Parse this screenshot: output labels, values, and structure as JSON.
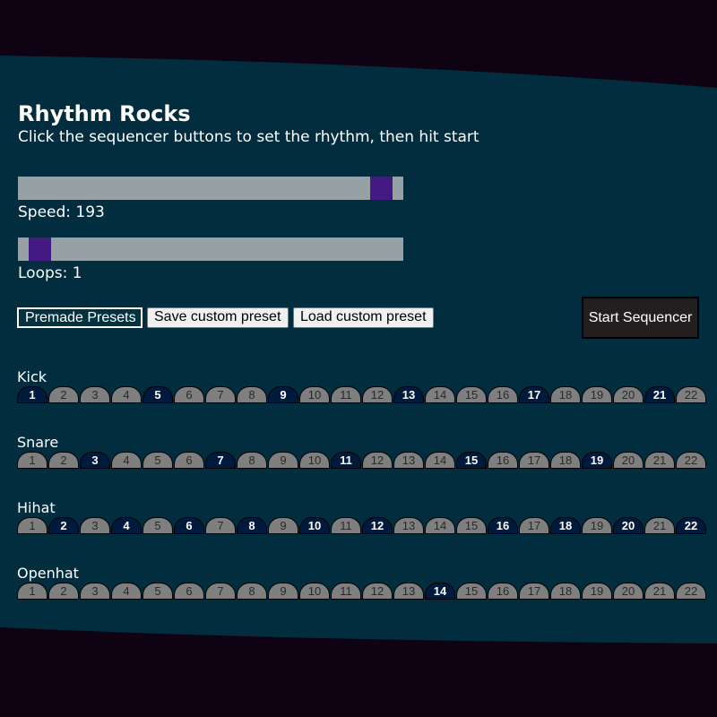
{
  "app": {
    "title": "Rhythm Rocks",
    "subtitle": "Click the sequencer buttons to set the rhythm, then hit start"
  },
  "colors": {
    "outer_bg": "#0f0213",
    "panel_bg": "#012d3e",
    "slider_track": "#95a1a5",
    "slider_thumb": "#441a82",
    "step_off": "#7f7f7f",
    "step_on": "#001a3d"
  },
  "sliders": {
    "speed": {
      "label": "Speed: 193",
      "fraction": 0.97
    },
    "loops": {
      "label": "Loops: 1",
      "fraction": 0.03
    }
  },
  "controls": {
    "presets_label": "Premade Presets",
    "save_label": "Save custom preset",
    "load_label": "Load custom preset",
    "start_label": "Start Sequencer"
  },
  "tracks": [
    {
      "name": "Kick",
      "steps": [
        "1",
        "2",
        "3",
        "4",
        "5",
        "6",
        "7",
        "8",
        "9",
        "10",
        "11",
        "12",
        "13",
        "14",
        "15",
        "16",
        "17",
        "18",
        "19",
        "20",
        "21",
        "22"
      ],
      "active": [
        1,
        5,
        9,
        13,
        17,
        21
      ]
    },
    {
      "name": "Snare",
      "steps": [
        "1",
        "2",
        "3",
        "4",
        "5",
        "6",
        "7",
        "8",
        "9",
        "10",
        "11",
        "12",
        "13",
        "14",
        "15",
        "16",
        "17",
        "18",
        "19",
        "20",
        "21",
        "22"
      ],
      "active": [
        3,
        7,
        11,
        15,
        19
      ]
    },
    {
      "name": "Hihat",
      "steps": [
        "1",
        "2",
        "3",
        "4",
        "5",
        "6",
        "7",
        "8",
        "9",
        "10",
        "11",
        "12",
        "13",
        "14",
        "15",
        "16",
        "17",
        "18",
        "19",
        "20",
        "21",
        "22"
      ],
      "active": [
        2,
        4,
        6,
        8,
        10,
        12,
        16,
        18,
        20,
        22
      ]
    },
    {
      "name": "Openhat",
      "steps": [
        "1",
        "2",
        "3",
        "4",
        "5",
        "6",
        "7",
        "8",
        "9",
        "10",
        "11",
        "12",
        "13",
        "14",
        "15",
        "16",
        "17",
        "18",
        "19",
        "20",
        "21",
        "22"
      ],
      "active": [
        14
      ]
    }
  ]
}
